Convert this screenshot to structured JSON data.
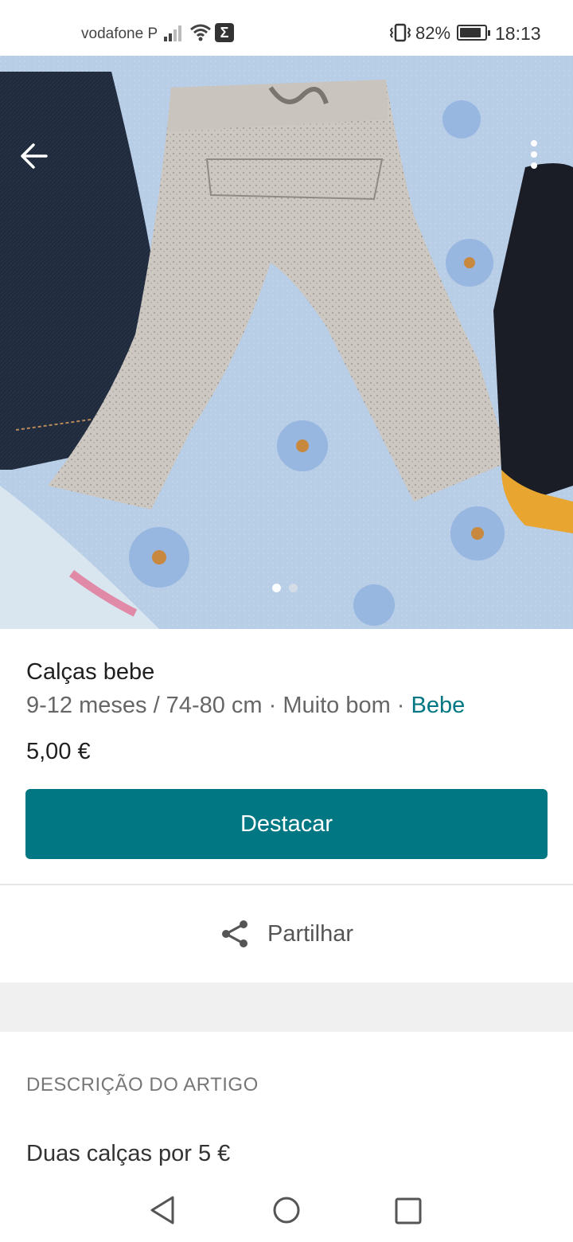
{
  "status_bar": {
    "carrier": "vodafone P",
    "sigma": "Σ",
    "battery_pct": "82%",
    "time": "18:13"
  },
  "gallery": {
    "dots_total": 2,
    "active_index": 0
  },
  "item": {
    "title": "Calças bebe",
    "size": "9-12 meses / 74-80 cm",
    "separator": " · ",
    "condition": "Muito bom",
    "category": "Bebe",
    "price": "5,00 €"
  },
  "actions": {
    "promote_label": "Destacar",
    "share_label": "Partilhar"
  },
  "description": {
    "header": "DESCRIÇÃO DO ARTIGO",
    "text": "Duas calças por 5 €"
  },
  "colors": {
    "accent": "#007782",
    "background": "#ffffff"
  },
  "icons": [
    "signal-icon",
    "wifi-icon",
    "sigma-icon",
    "vibrate-icon",
    "battery-icon",
    "back-arrow-icon",
    "more-vert-icon",
    "share-icon",
    "nav-back-icon",
    "nav-home-icon",
    "nav-recent-icon"
  ]
}
